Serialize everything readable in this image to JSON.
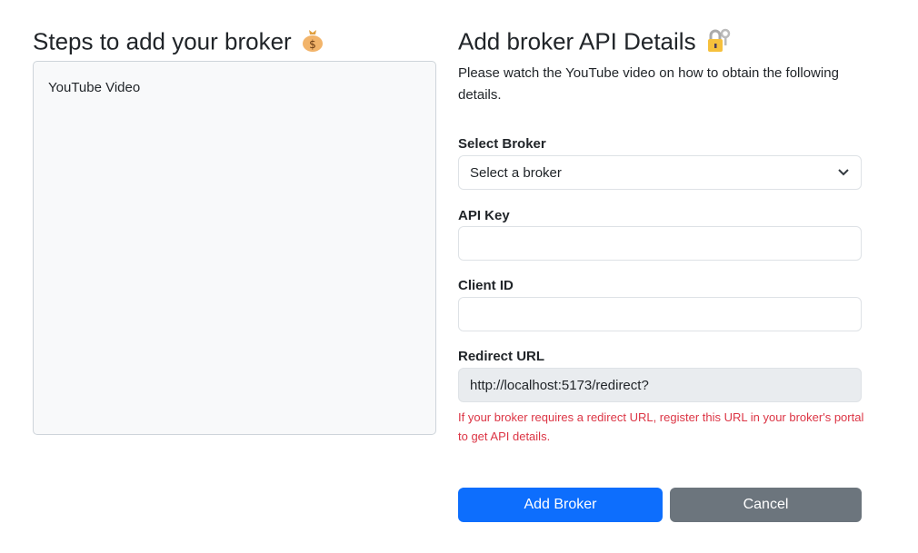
{
  "left": {
    "title": "Steps to add your broker",
    "panel_text": "YouTube Video"
  },
  "right": {
    "title": "Add broker API Details",
    "intro": "Please watch the YouTube video on how to obtain the following details.",
    "broker_label": "Select Broker",
    "broker_value": "Select a broker",
    "api_key_label": "API Key",
    "api_key_value": "",
    "client_id_label": "Client ID",
    "client_id_value": "",
    "redirect_label": "Redirect URL",
    "redirect_value": "http://localhost:5173/redirect?",
    "help": "If your broker requires a redirect URL, register this URL in your broker's portal to get API details.",
    "add_label": "Add Broker",
    "cancel_label": "Cancel"
  },
  "colors": {
    "primary": "#0d6efd",
    "secondary": "#6c757d",
    "danger": "#dc3545"
  }
}
